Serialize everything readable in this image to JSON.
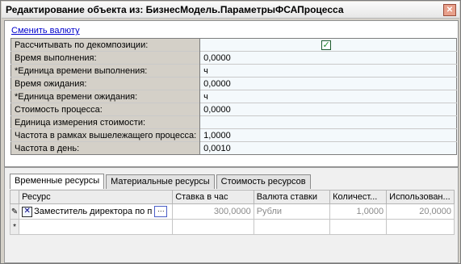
{
  "window": {
    "title": "Редактирование объекта из: БизнесМодель.ПараметрыФСАПроцесса",
    "close_glyph": "✕"
  },
  "top": {
    "change_currency_link": "Сменить валюту"
  },
  "properties": [
    {
      "label": "Рассчитывать по декомпозиции:",
      "value": "",
      "checked": true
    },
    {
      "label": "Время выполнения:",
      "value": "0,0000"
    },
    {
      "label": "*Единица времени выполнения:",
      "value": "ч"
    },
    {
      "label": "Время ожидания:",
      "value": "0,0000"
    },
    {
      "label": "*Единица времени ожидания:",
      "value": "ч"
    },
    {
      "label": "Стоимость процесса:",
      "value": "0,0000"
    },
    {
      "label": "Единица измерения стоимости:",
      "value": ""
    },
    {
      "label": "Частота в рамках вышележащего процесса:",
      "value": "1,0000"
    },
    {
      "label": "Частота в день:",
      "value": "0,0010"
    }
  ],
  "checkbox_glyph": "✓",
  "tabs": [
    "Временные ресурсы",
    "Материальные ресурсы",
    "Стоимость ресурсов"
  ],
  "grid": {
    "headers": [
      "Ресурс",
      "Ставка в час",
      "Валюта ставки",
      "Количест...",
      "Использован..."
    ],
    "row1": {
      "marker": "✎",
      "x_glyph": "✕",
      "resource": "Заместитель директора по п",
      "dots": "···",
      "rate": "300,0000",
      "currency": "Рубли",
      "quantity": "1,0000",
      "usage": "20,0000"
    },
    "new_row_marker": "*"
  }
}
